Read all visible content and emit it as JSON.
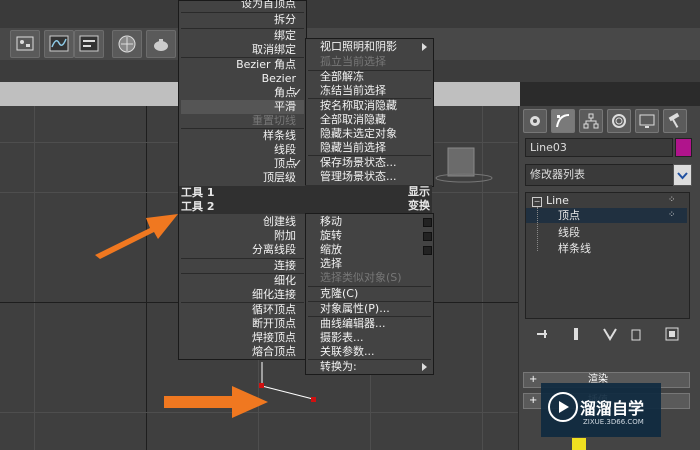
{
  "context_menu": {
    "left_items": [
      {
        "label": "设为首顶点",
        "disabled": false
      },
      {
        "label": "拆分",
        "disabled": false
      },
      {
        "label": "绑定",
        "disabled": false
      },
      {
        "label": "取消绑定",
        "disabled": false
      },
      {
        "label": "Bezier 角点",
        "disabled": false
      },
      {
        "label": "Bezier",
        "disabled": false
      },
      {
        "label": "角点",
        "disabled": false,
        "checked": true
      },
      {
        "label": "平滑",
        "disabled": false,
        "highlighted": true
      },
      {
        "label": "重置切线",
        "disabled": true
      },
      {
        "label": "样条线",
        "disabled": false
      },
      {
        "label": "线段",
        "disabled": false
      },
      {
        "label": "顶点",
        "disabled": false,
        "checked": true
      },
      {
        "label": "顶层级",
        "disabled": false
      }
    ],
    "quad_headers": {
      "tools1_left": "工具 1",
      "tools1_right": "显示",
      "tools2_left": "工具 2",
      "tools2_right": "变换"
    },
    "left_tools": [
      {
        "label": "创建线"
      },
      {
        "label": "附加"
      },
      {
        "label": "分离线段"
      },
      {
        "label": "连接"
      },
      {
        "label": "细化"
      },
      {
        "label": "细化连接"
      },
      {
        "label": "循环顶点"
      },
      {
        "label": "断开顶点"
      },
      {
        "label": "焊接顶点"
      },
      {
        "label": "熔合顶点"
      }
    ],
    "right_display": [
      {
        "label": "视口照明和阴影",
        "submenu": true,
        "disabled": false
      },
      {
        "label": "孤立当前选择",
        "disabled": true
      },
      {
        "label": "全部解冻",
        "disabled": false
      },
      {
        "label": "冻结当前选择",
        "disabled": false
      },
      {
        "label": "按名称取消隐藏",
        "disabled": false
      },
      {
        "label": "全部取消隐藏",
        "disabled": false
      },
      {
        "label": "隐藏未选定对象",
        "disabled": false
      },
      {
        "label": "隐藏当前选择",
        "disabled": false
      },
      {
        "label": "保存场景状态...",
        "disabled": false
      },
      {
        "label": "管理场景状态...",
        "disabled": false
      }
    ],
    "right_transform": [
      {
        "label": "移动",
        "box": true,
        "disabled": false
      },
      {
        "label": "旋转",
        "box": true,
        "disabled": false
      },
      {
        "label": "缩放",
        "box": true,
        "disabled": false
      },
      {
        "label": "选择",
        "disabled": false
      },
      {
        "label": "选择类似对象(S)",
        "disabled": true
      },
      {
        "label": "克隆(C)",
        "disabled": false
      },
      {
        "label": "对象属性(P)...",
        "disabled": false
      },
      {
        "label": "曲线编辑器...",
        "disabled": false
      },
      {
        "label": "摄影表...",
        "disabled": false
      },
      {
        "label": "关联参数...",
        "disabled": false
      },
      {
        "label": "转换为:",
        "submenu": true,
        "disabled": false
      }
    ]
  },
  "command_panel": {
    "object_name": "Line03",
    "object_color": "#b0148c",
    "modifier_list": "修改器列表",
    "stack": [
      {
        "label": "Line",
        "level": 0
      },
      {
        "label": "顶点",
        "level": 1,
        "selected": true
      },
      {
        "label": "线段",
        "level": 1
      },
      {
        "label": "样条线",
        "level": 1
      }
    ],
    "rollouts": [
      "渲染",
      "插值"
    ]
  },
  "watermark": {
    "title": "溜溜自学",
    "url": "ZIXUE.3D66.COM"
  },
  "colors": {
    "accent_arrow": "#f07820",
    "highlight": "#203040",
    "menu_bg": "#434343"
  }
}
